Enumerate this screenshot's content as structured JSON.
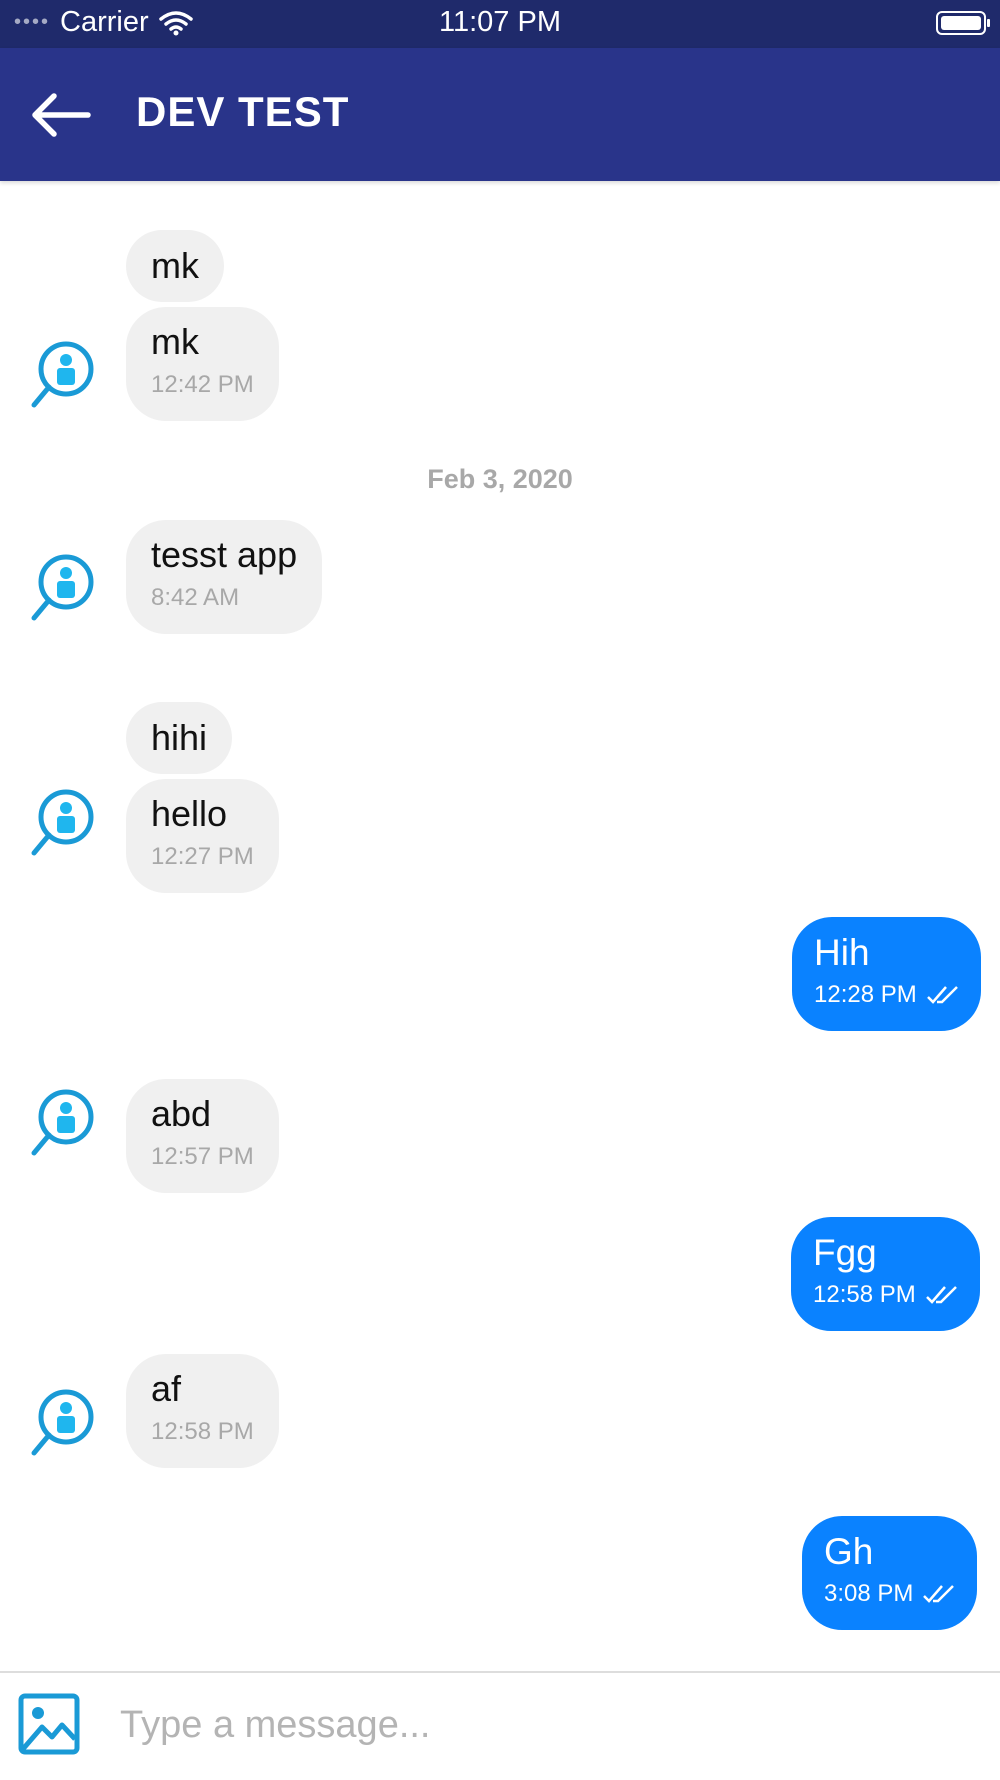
{
  "status_bar": {
    "carrier": "Carrier",
    "signal_dots": "••••",
    "time": "11:07 PM"
  },
  "header": {
    "title": "DEV TEST"
  },
  "messages": [
    {
      "text": "mk"
    },
    {
      "text": "mk",
      "time": "12:42 PM"
    },
    {
      "date_separator": "Feb 3, 2020"
    },
    {
      "text": "tesst app",
      "time": "8:42 AM"
    },
    {
      "text": "hihi"
    },
    {
      "text": "hello",
      "time": "12:27 PM"
    },
    {
      "text": "Hih",
      "time": "12:28 PM",
      "outgoing": true,
      "status": "read"
    },
    {
      "text": "abd",
      "time": "12:57 PM"
    },
    {
      "text": "Fgg",
      "time": "12:58 PM",
      "outgoing": true,
      "status": "read"
    },
    {
      "text": "af",
      "time": "12:58 PM"
    },
    {
      "text": "Gh",
      "time": "3:08 PM",
      "outgoing": true,
      "status": "read"
    }
  ],
  "composer": {
    "placeholder": "Type a message..."
  },
  "colors": {
    "header": "#29348a",
    "status_bar": "#1f2a6b",
    "outgoing_bubble": "#0a82ff",
    "incoming_bubble": "#f0f0f0",
    "avatar": "#1a9ad6"
  }
}
